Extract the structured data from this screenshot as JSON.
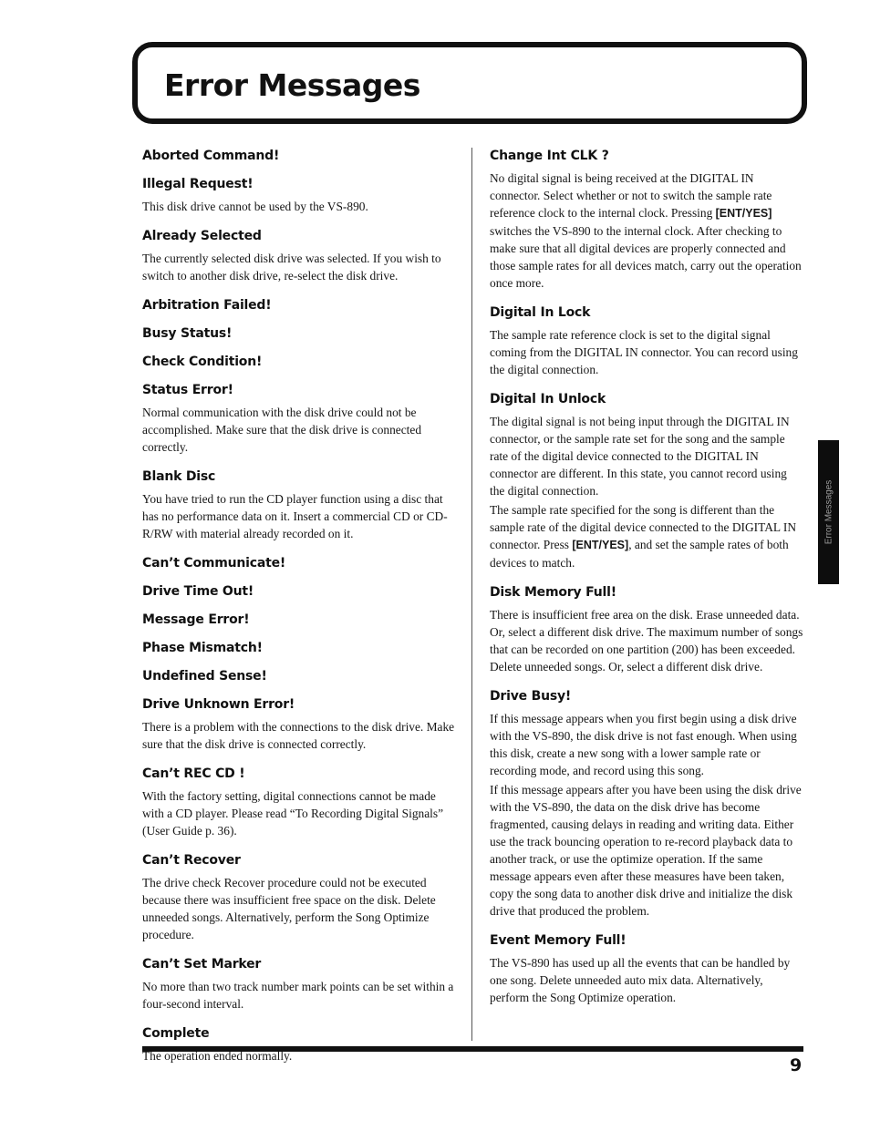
{
  "page": {
    "title": "Error Messages",
    "side_tab": "Error Messages",
    "page_number": "9"
  },
  "left_column": [
    {
      "headings": [
        "Aborted Command!",
        "Illegal Request!"
      ],
      "paragraphs": [
        "This disk drive cannot be used by the VS-890."
      ]
    },
    {
      "headings": [
        "Already Selected"
      ],
      "paragraphs": [
        "The currently selected disk drive was selected. If you wish to switch to another disk drive, re-select the disk drive."
      ]
    },
    {
      "headings": [
        "Arbitration Failed!",
        "Busy Status!",
        "Check Condition!",
        "Status Error!"
      ],
      "paragraphs": [
        "Normal communication with the disk drive could not be accomplished. Make sure that the disk drive is connected correctly."
      ]
    },
    {
      "headings": [
        "Blank Disc"
      ],
      "paragraphs": [
        "You have tried to run the CD player function using a disc that has no performance data on it. Insert a commercial CD or CD-R/RW with material already recorded on it."
      ]
    },
    {
      "headings": [
        "Can’t Communicate!",
        "Drive Time Out!",
        "Message Error!",
        "Phase Mismatch!",
        "Undefined Sense!",
        "Drive Unknown Error!"
      ],
      "paragraphs": [
        "There is a problem with the connections to the disk drive. Make sure that the disk drive is connected correctly."
      ]
    },
    {
      "headings": [
        "Can’t REC CD !"
      ],
      "paragraphs": [
        "With the factory setting, digital connections cannot be made with a CD player. Please read “To Recording Digital Signals” (User Guide p. 36)."
      ]
    },
    {
      "headings": [
        "Can’t Recover"
      ],
      "paragraphs": [
        "The drive check Recover procedure could not be executed because there was insufficient free space on the disk. Delete unneeded songs. Alternatively, perform the Song Optimize procedure."
      ]
    },
    {
      "headings": [
        "Can’t Set Marker"
      ],
      "paragraphs": [
        "No more than two track number mark points can be set within a four-second interval."
      ]
    },
    {
      "headings": [
        "Complete"
      ],
      "paragraphs": [
        "The operation ended normally."
      ]
    }
  ],
  "right_column": [
    {
      "headings": [
        "Change Int CLK ?"
      ],
      "paragraphs": [
        {
          "before": "No digital signal is being received at the DIGITAL IN connector. Select whether or not to switch the sample rate reference clock to the internal clock. Pressing ",
          "key": "[ENT/YES]",
          "after": " switches the VS-890 to the internal clock. After checking to make sure that all digital devices are properly connected and those sample rates for all devices match, carry out the operation once more."
        }
      ]
    },
    {
      "headings": [
        "Digital In Lock"
      ],
      "paragraphs": [
        {
          "before": "The sample rate reference clock is set to the digital signal coming from the DIGITAL IN connector. You can record using the digital connection.",
          "key": "",
          "after": ""
        }
      ]
    },
    {
      "headings": [
        "Digital In Unlock"
      ],
      "paragraphs": [
        {
          "before": "The digital signal is not being input through the DIGITAL IN connector, or the sample rate set for the song and the sample rate of the digital device connected to the DIGITAL IN connector are different. In this state, you cannot record using the digital connection.",
          "key": "",
          "after": ""
        },
        {
          "before": "The sample rate specified for the song is different than the sample rate of the digital device connected to the DIGITAL IN connector. Press ",
          "key": "[ENT/YES]",
          "after": ", and set the sample rates of both devices to match."
        }
      ]
    },
    {
      "headings": [
        "Disk Memory Full!"
      ],
      "paragraphs": [
        {
          "before": "There is insufficient free area on the disk. Erase unneeded data. Or, select a different disk drive. The maximum number of songs that can be recorded on one partition (200) has been exceeded. Delete unneeded songs. Or, select a different disk drive.",
          "key": "",
          "after": ""
        }
      ]
    },
    {
      "headings": [
        "Drive Busy!"
      ],
      "paragraphs": [
        {
          "before": "If this message appears when you first begin using a disk drive with the VS-890, the disk drive is not fast enough. When using this disk, create a new song with a lower sample rate or recording mode, and record using this song.",
          "key": "",
          "after": ""
        },
        {
          "before": "If this message appears after you have been using the disk drive with the VS-890, the data on the disk drive has become fragmented, causing delays in reading and writing data. Either use the track bouncing operation to re-record playback data to another track, or use the optimize operation. If the same message appears even after these measures have been taken, copy the song data to another disk drive and initialize the disk drive that produced the problem.",
          "key": "",
          "after": ""
        }
      ]
    },
    {
      "headings": [
        "Event Memory Full!"
      ],
      "paragraphs": [
        {
          "before": "The VS-890 has used up all the events that can be handled by one song. Delete unneeded auto mix data. Alternatively, perform the Song Optimize operation.",
          "key": "",
          "after": ""
        }
      ]
    }
  ]
}
